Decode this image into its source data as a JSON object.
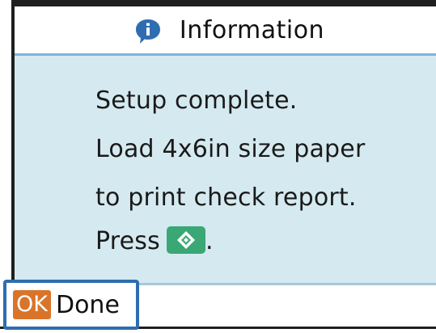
{
  "header": {
    "title": "Information",
    "icon": "info-speech-bubble-icon",
    "icon_color": "#2e6db0"
  },
  "message": {
    "lines": [
      "Setup complete.",
      "Load 4x6in size paper",
      "to print check report.",
      "Press"
    ],
    "trailing": ".",
    "start_button_icon": "start-diamond-icon",
    "start_button_color": "#3aa874"
  },
  "footer": {
    "ok_label": "OK",
    "done_label": "Done",
    "ok_color": "#d9742a",
    "focus_color": "#2e6db0"
  },
  "colors": {
    "panel_background": "#d5eaf0",
    "header_divider": "#7fb2d8"
  }
}
